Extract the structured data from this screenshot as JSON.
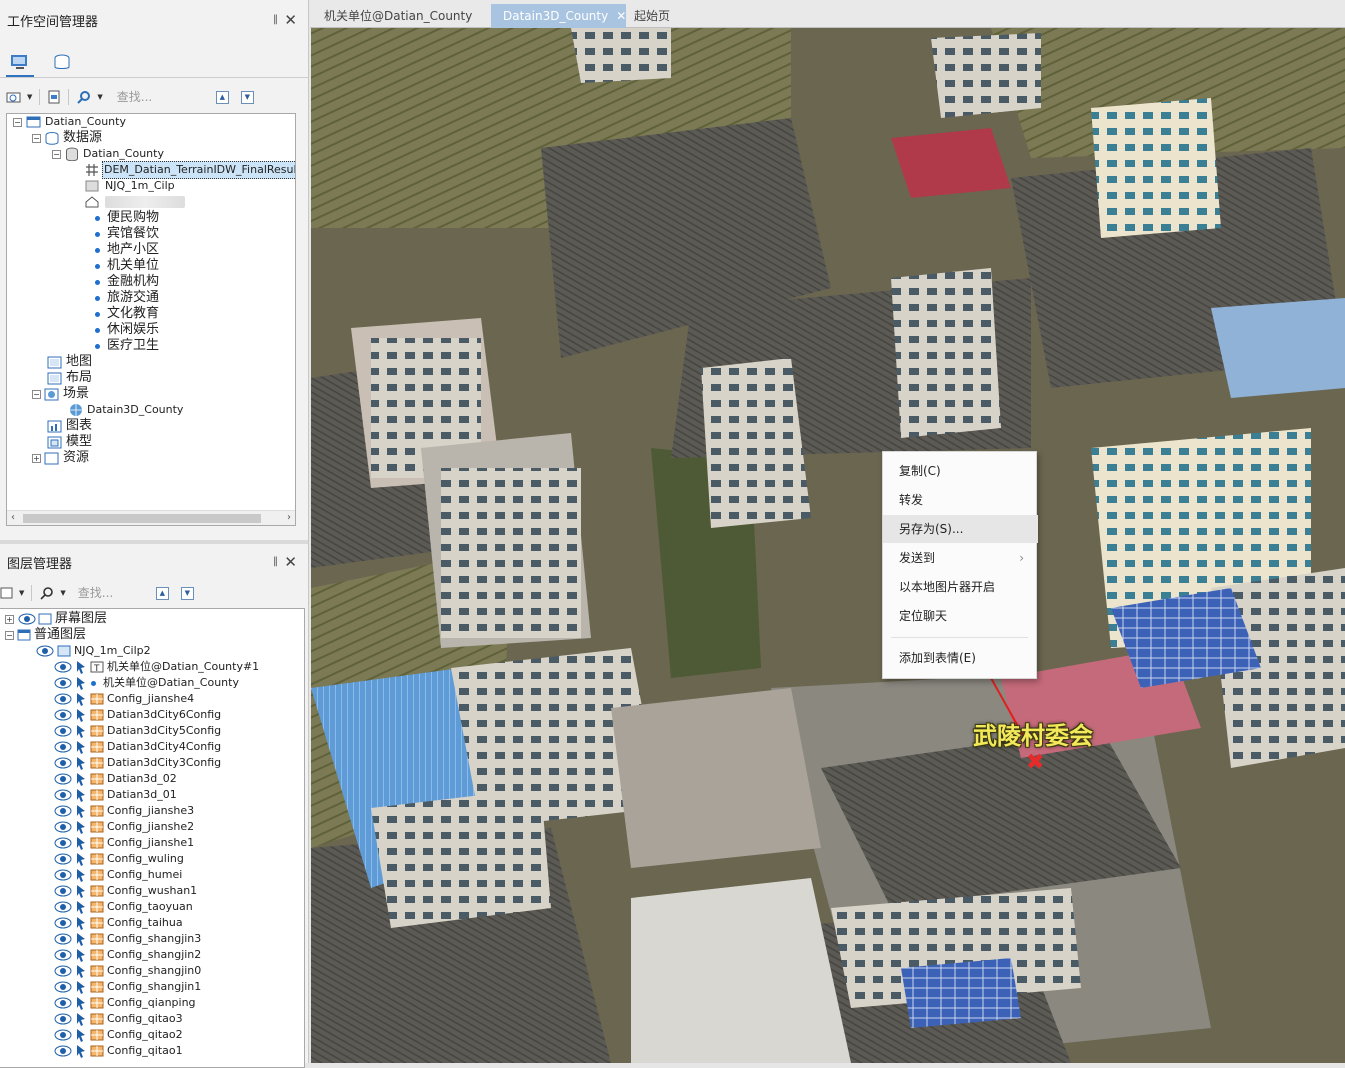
{
  "workspace_panel": {
    "title": "工作空间管理器",
    "pin": "‖",
    "close": "✕",
    "search_placeholder": "查找..."
  },
  "workspace_tree": {
    "root": "Datian_County",
    "datasources": "数据源",
    "datasource": "Datian_County",
    "datasets": [
      "DEM_Datian_TerrainIDW_FinalResult",
      "NJQ_1m_Cilp",
      "便民购物",
      "宾馆餐饮",
      "地产小区",
      "机关单位",
      "金融机构",
      "旅游交通",
      "文化教育",
      "休闲娱乐",
      "医疗卫生"
    ],
    "maps": "地图",
    "layouts": "布局",
    "scenes": "场景",
    "scene": "Datain3D_County",
    "charts": "图表",
    "models": "模型",
    "resources": "资源"
  },
  "layer_panel": {
    "title": "图层管理器",
    "pin": "‖",
    "close": "✕",
    "search_placeholder": "查找...",
    "screen_layers": "屏幕图层",
    "normal_layers": "普通图层",
    "layers": [
      "NJQ_1m_Cilp2",
      "机关单位@Datian_County#1",
      "机关单位@Datian_County",
      "Config_jianshe4",
      "Datian3dCity6Config",
      "Datian3dCity5Config",
      "Datian3dCity4Config",
      "Datian3dCity3Config",
      "Datian3d_02",
      "Datian3d_01",
      "Config_jianshe3",
      "Config_jianshe2",
      "Config_jianshe1",
      "Config_wuling",
      "Config_humei",
      "Config_wushan1",
      "Config_taoyuan",
      "Config_taihua",
      "Config_shangjin3",
      "Config_shangjin2",
      "Config_shangjin0",
      "Config_shangjin1",
      "Config_qianping",
      "Config_qitao3",
      "Config_qitao2",
      "Config_qitao1"
    ]
  },
  "doc_tabs": {
    "tab1": "机关单位@Datian_County",
    "tab2": "Datain3D_County",
    "tab2_close": "✕",
    "tab3": "起始页"
  },
  "context_menu": {
    "copy": "复制(C)",
    "forward": "转发",
    "save_as": "另存为(S)...",
    "send_to": "发送到",
    "open_with_viewer": "以本地图片器开启",
    "locate_chat": "定位聊天",
    "add_to_sticker": "添加到表情(E)"
  },
  "map": {
    "label": "武陵村委会",
    "marker": "✖"
  }
}
